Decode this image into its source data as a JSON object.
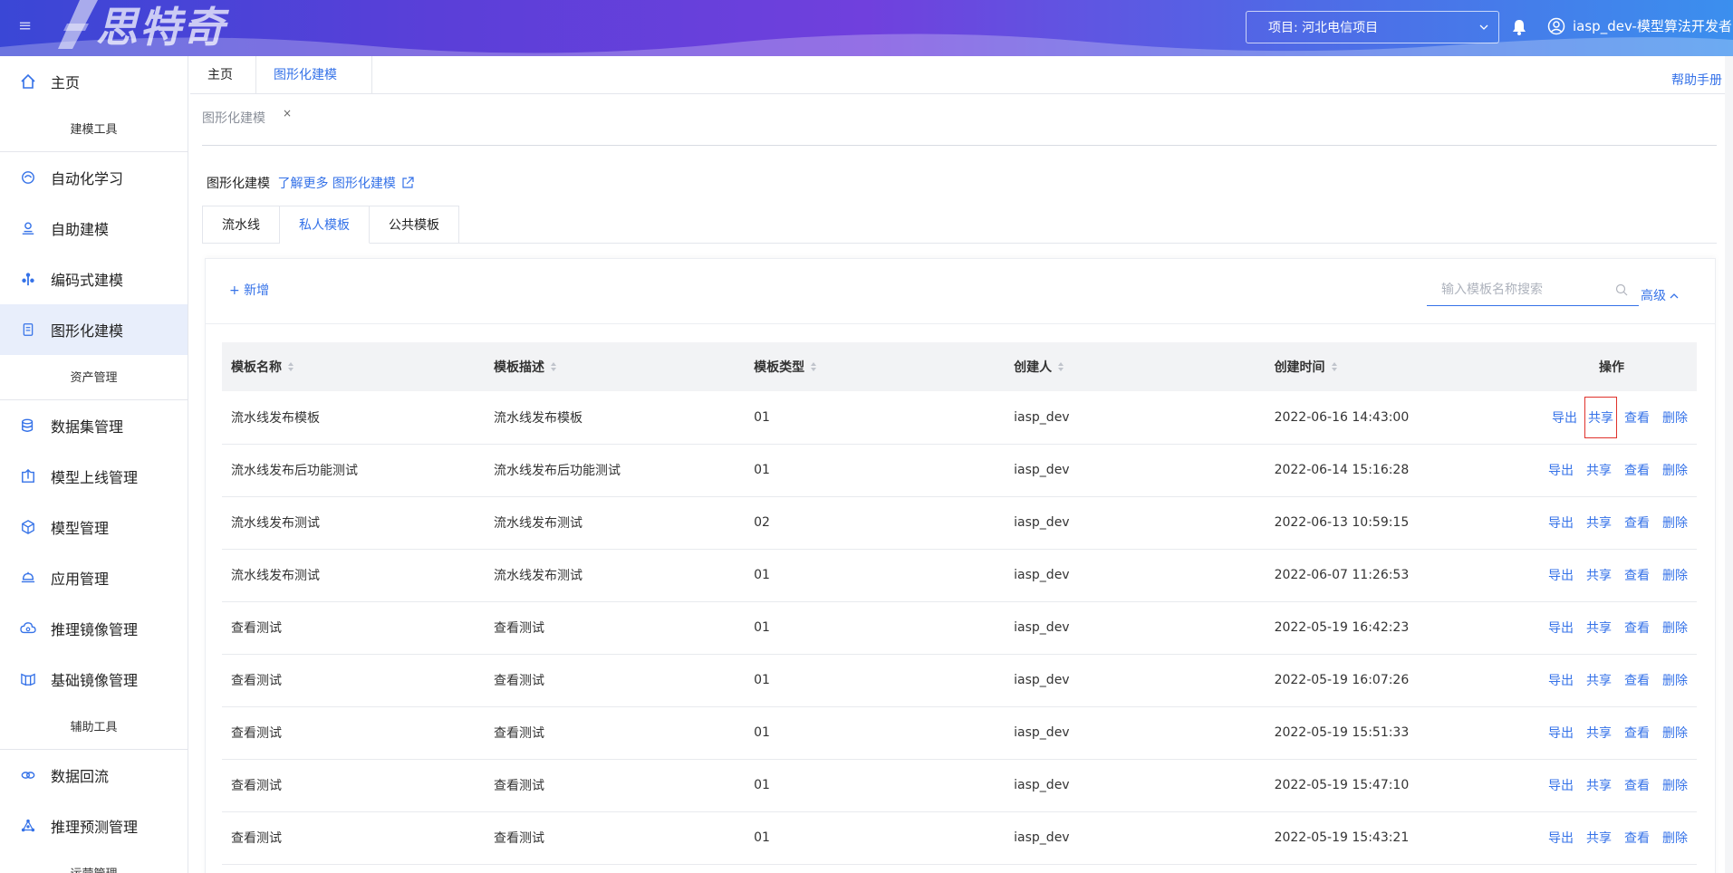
{
  "header": {
    "logo_text": "思特奇",
    "project_label": "项目: 河北电信项目",
    "user_label": "iasp_dev-模型算法开发者"
  },
  "sidebar": {
    "items": [
      {
        "label": "主页",
        "icon": "home-icon"
      },
      {
        "group": "建模工具"
      },
      {
        "label": "自动化学习",
        "icon": "auto-learn-icon"
      },
      {
        "label": "自助建模",
        "icon": "self-model-icon"
      },
      {
        "label": "编码式建模",
        "icon": "code-model-icon"
      },
      {
        "label": "图形化建模",
        "icon": "graph-model-icon",
        "active": true
      },
      {
        "group": "资产管理"
      },
      {
        "label": "数据集管理",
        "icon": "database-icon"
      },
      {
        "label": "模型上线管理",
        "icon": "upload-icon"
      },
      {
        "label": "模型管理",
        "icon": "cube-icon"
      },
      {
        "label": "应用管理",
        "icon": "app-icon"
      },
      {
        "label": "推理镜像管理",
        "icon": "cloud-icon"
      },
      {
        "label": "基础镜像管理",
        "icon": "image-icon"
      },
      {
        "group": "辅助工具"
      },
      {
        "label": "数据回流",
        "icon": "loop-icon"
      },
      {
        "label": "推理预测管理",
        "icon": "predict-icon"
      },
      {
        "group": "运营管理"
      }
    ]
  },
  "tabs": {
    "home": "主页",
    "current": "图形化建模",
    "close": "×",
    "help": "帮助手册"
  },
  "breadcrumb": "图形化建模",
  "description": {
    "text": "图形化建模",
    "link": "了解更多 图形化建模"
  },
  "subtabs": [
    "流水线",
    "私人模板",
    "公共模板"
  ],
  "toolbar": {
    "add_label": "+ 新增",
    "search_placeholder": "输入模板名称搜索",
    "advanced_label": "高级"
  },
  "table": {
    "columns": [
      "模板名称",
      "模板描述",
      "模板类型",
      "创建人",
      "创建时间",
      "操作"
    ],
    "actions": [
      "导出",
      "共享",
      "查看",
      "删除"
    ],
    "rows": [
      [
        "流水线发布模板",
        "流水线发布模板",
        "01",
        "iasp_dev",
        "2022-06-16 14:43:00"
      ],
      [
        "流水线发布后功能测试",
        "流水线发布后功能测试",
        "01",
        "iasp_dev",
        "2022-06-14 15:16:28"
      ],
      [
        "流水线发布测试",
        "流水线发布测试",
        "02",
        "iasp_dev",
        "2022-06-13 10:59:15"
      ],
      [
        "流水线发布测试",
        "流水线发布测试",
        "01",
        "iasp_dev",
        "2022-06-07 11:26:53"
      ],
      [
        "查看测试",
        "查看测试",
        "01",
        "iasp_dev",
        "2022-05-19 16:42:23"
      ],
      [
        "查看测试",
        "查看测试",
        "01",
        "iasp_dev",
        "2022-05-19 16:07:26"
      ],
      [
        "查看测试",
        "查看测试",
        "01",
        "iasp_dev",
        "2022-05-19 15:51:33"
      ],
      [
        "查看测试",
        "查看测试",
        "01",
        "iasp_dev",
        "2022-05-19 15:47:10"
      ],
      [
        "查看测试",
        "查看测试",
        "01",
        "iasp_dev",
        "2022-05-19 15:43:21"
      ]
    ]
  },
  "colors": {
    "accent": "#3572e8",
    "highlight_box": "#e0322b",
    "active_nav_bg": "#e8eefb"
  }
}
